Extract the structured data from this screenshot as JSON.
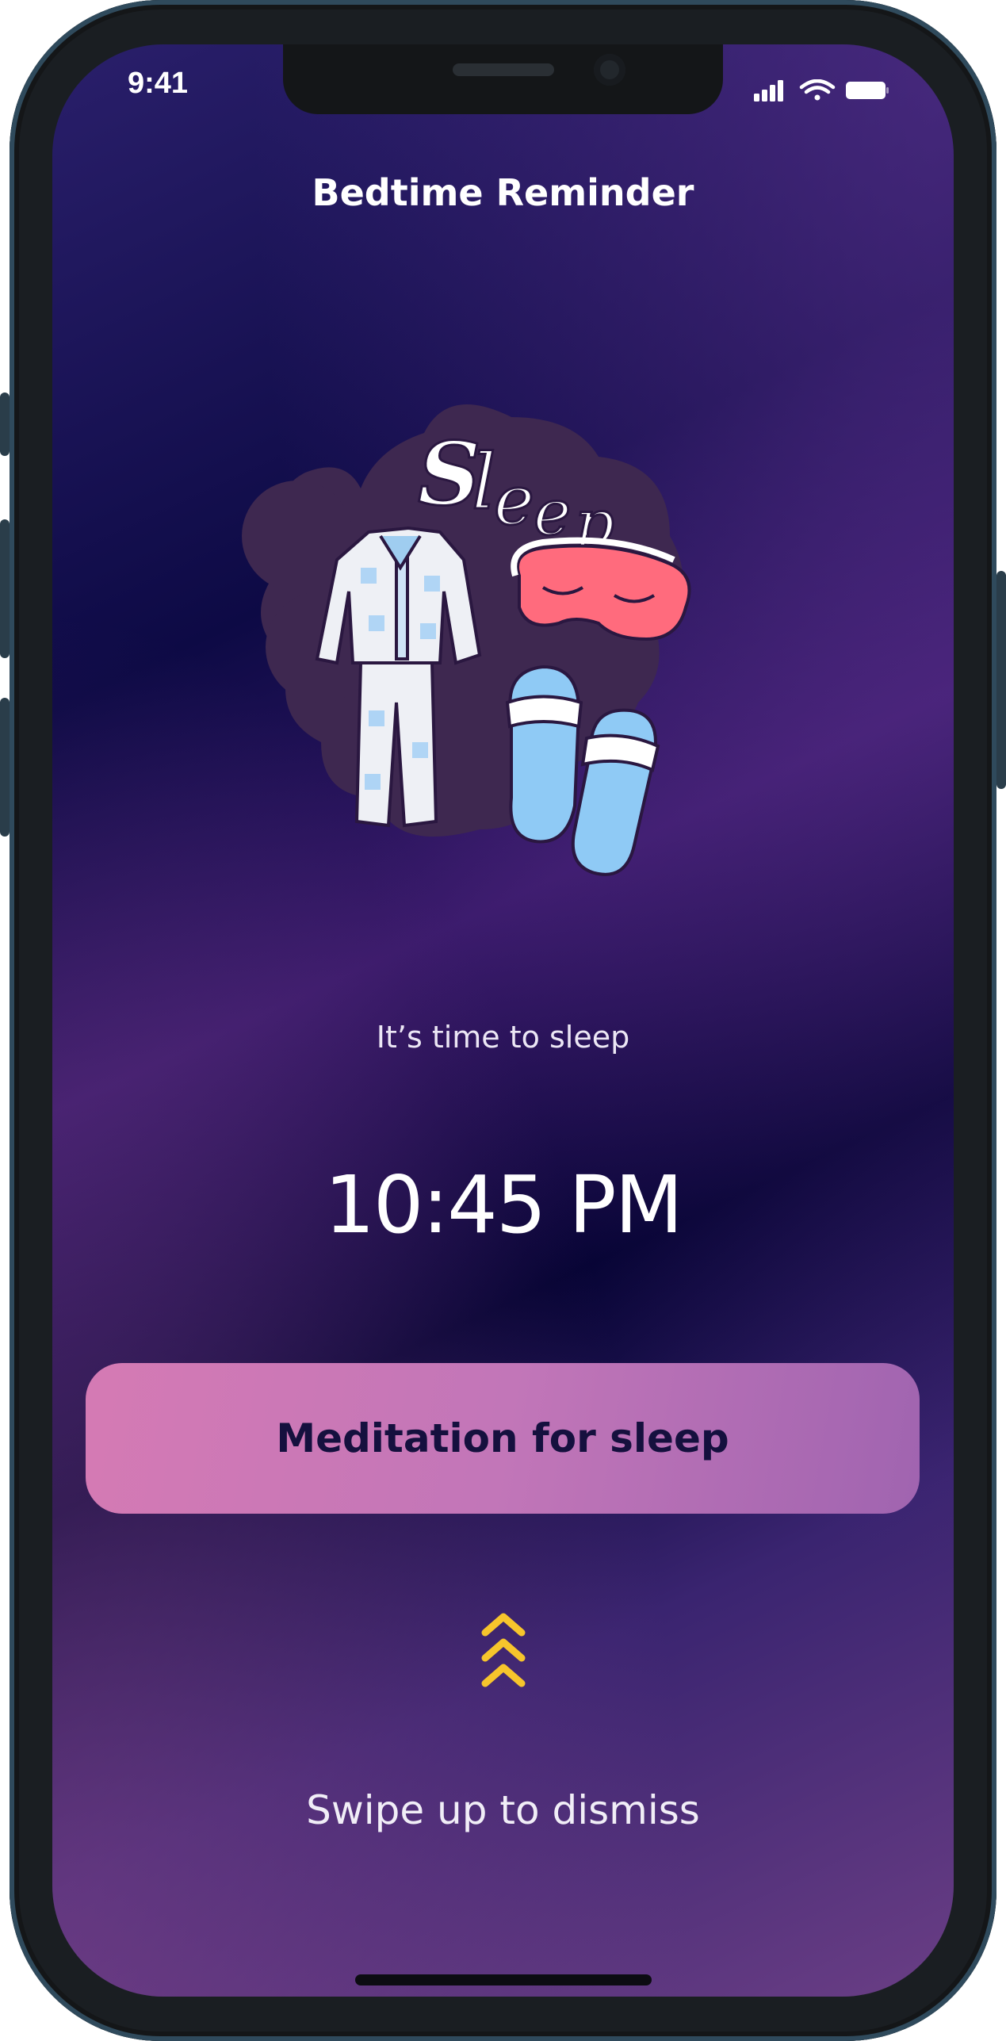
{
  "status_bar": {
    "time": "9:41",
    "icons": [
      "signal-icon",
      "wifi-icon",
      "battery-icon"
    ]
  },
  "header": {
    "title": "Bedtime Reminder"
  },
  "illustration": {
    "text": "Sleep...",
    "items": [
      "pajamas",
      "sleep-mask",
      "slippers"
    ]
  },
  "reminder": {
    "message": "It’s time to sleep",
    "time": "10:45 PM"
  },
  "actions": {
    "meditation_label": "Meditation for sleep"
  },
  "footer": {
    "swipe_icon": "triple-chevron-up-icon",
    "dismiss_label": "Swipe up to dismiss"
  },
  "colors": {
    "accent_button": "#c978b6",
    "button_text": "#15103e",
    "chevron": "#f7c52c",
    "background_dark": "#0d0a45",
    "background_purple": "#6a3e85"
  }
}
